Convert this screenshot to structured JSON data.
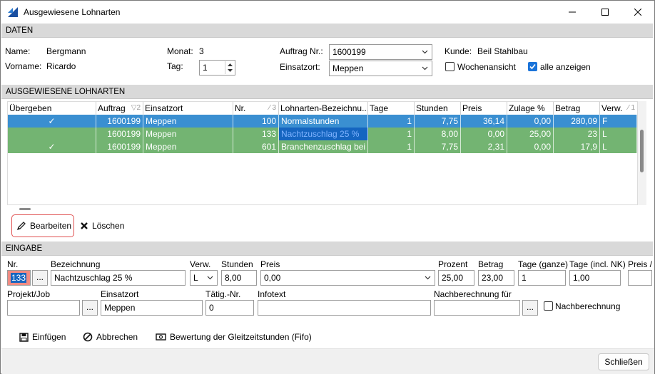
{
  "window": {
    "title": "Ausgewiesene Lohnarten"
  },
  "daten": {
    "header": "DATEN",
    "name_label": "Name:",
    "name": "Bergmann",
    "vorname_label": "Vorname:",
    "vorname": "Ricardo",
    "monat_label": "Monat:",
    "monat": "3",
    "tag_label": "Tag:",
    "tag": "1",
    "auftrag_label": "Auftrag Nr.:",
    "auftrag": "1600199",
    "einsatzort_label": "Einsatzort:",
    "einsatzort": "Meppen",
    "kunde_label": "Kunde:",
    "kunde": "Beil Stahlbau",
    "wochenansicht_label": "Wochenansicht",
    "alle_anzeigen_label": "alle anzeigen"
  },
  "lohnarten": {
    "header": "AUSGEWIESENE LOHNARTEN",
    "columns": [
      "Übergeben",
      "Auftrag",
      "Einsatzort",
      "Nr.",
      "Lohnarten-Bezeichnu...",
      "Tage",
      "Stunden",
      "Preis",
      "Zulage %",
      "Betrag",
      "Verw."
    ],
    "sort_markers": {
      "auftrag": "2",
      "nr": "3",
      "verw": "1"
    },
    "rows": [
      {
        "uebergeben": "✓",
        "auftrag": "1600199",
        "einsatzort": "Meppen",
        "nr": "100",
        "bezeichnung": "Normalstunden",
        "tage": "1",
        "stunden": "7,75",
        "preis": "36,14",
        "zulage": "0,00",
        "betrag": "280,09",
        "verw": "F"
      },
      {
        "uebergeben": "",
        "auftrag": "1600199",
        "einsatzort": "Meppen",
        "nr": "133",
        "bezeichnung": "Nachtzuschlag 25 %",
        "tage": "1",
        "stunden": "8,00",
        "preis": "0,00",
        "zulage": "25,00",
        "betrag": "23",
        "verw": "L"
      },
      {
        "uebergeben": "✓",
        "auftrag": "1600199",
        "einsatzort": "Meppen",
        "nr": "601",
        "bezeichnung": "Branchenzuschlag bei V",
        "tage": "1",
        "stunden": "7,75",
        "preis": "2,31",
        "zulage": "0,00",
        "betrag": "17,9",
        "verw": "L"
      }
    ],
    "bearbeiten_label": "Bearbeiten",
    "loeschen_label": "Löschen"
  },
  "eingabe": {
    "header": "EINGABE",
    "nr_label": "Nr.",
    "nr": "133",
    "bezeichnung_label": "Bezeichnung",
    "bezeichnung": "Nachtzuschlag 25 %",
    "verw_label": "Verw.",
    "verw": "L",
    "stunden_label": "Stunden",
    "stunden": "8,00",
    "preis_label": "Preis",
    "preis": "0,00",
    "prozent_label": "Prozent",
    "prozent": "25,00",
    "betrag_label": "Betrag",
    "betrag": "23,00",
    "tage_ganze_label": "Tage (ganze)",
    "tage_ganze": "1",
    "tage_nk_label": "Tage (incl. NK)",
    "tage_nk": "1,00",
    "preis2_label": "Preis /",
    "projekt_label": "Projekt/Job",
    "projekt": "",
    "einsatzort_label": "Einsatzort",
    "einsatzort": "Meppen",
    "taetig_label": "Tätig.-Nr.",
    "taetig": "0",
    "infotext_label": "Infotext",
    "infotext": "",
    "nachberechnung_fuer_label": "Nachberechnung für",
    "nachberechnung_fuer": "",
    "nachberechnung_label": "Nachberechnung",
    "ellipsis": "..."
  },
  "actions": {
    "einfuegen": "Einfügen",
    "abbrechen": "Abbrechen",
    "bewertung": "Bewertung der Gleitzeitstunden (Fifo)"
  },
  "footer": {
    "schliessen": "Schließen"
  },
  "colors": {
    "accent": "#1a73d9",
    "row_selected": "#3a8fd1",
    "row_green": "#73b472",
    "focus_red": "#e05050"
  }
}
